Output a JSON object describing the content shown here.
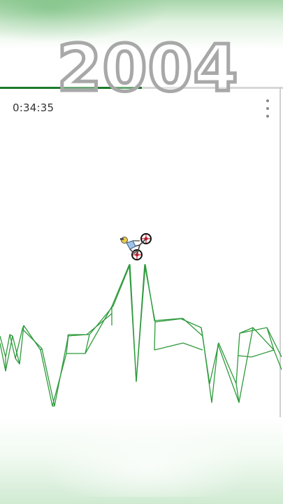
{
  "overlay": {
    "year_title": "2004"
  },
  "hud": {
    "timer": "0:34:35",
    "menu_icon": "more-vertical-icon"
  },
  "progress": {
    "fraction": 0.5
  },
  "colors": {
    "terrain": "#2e9a3c",
    "progress_fill": "#1b7a2a",
    "title_outline": "#a8a8a8"
  }
}
